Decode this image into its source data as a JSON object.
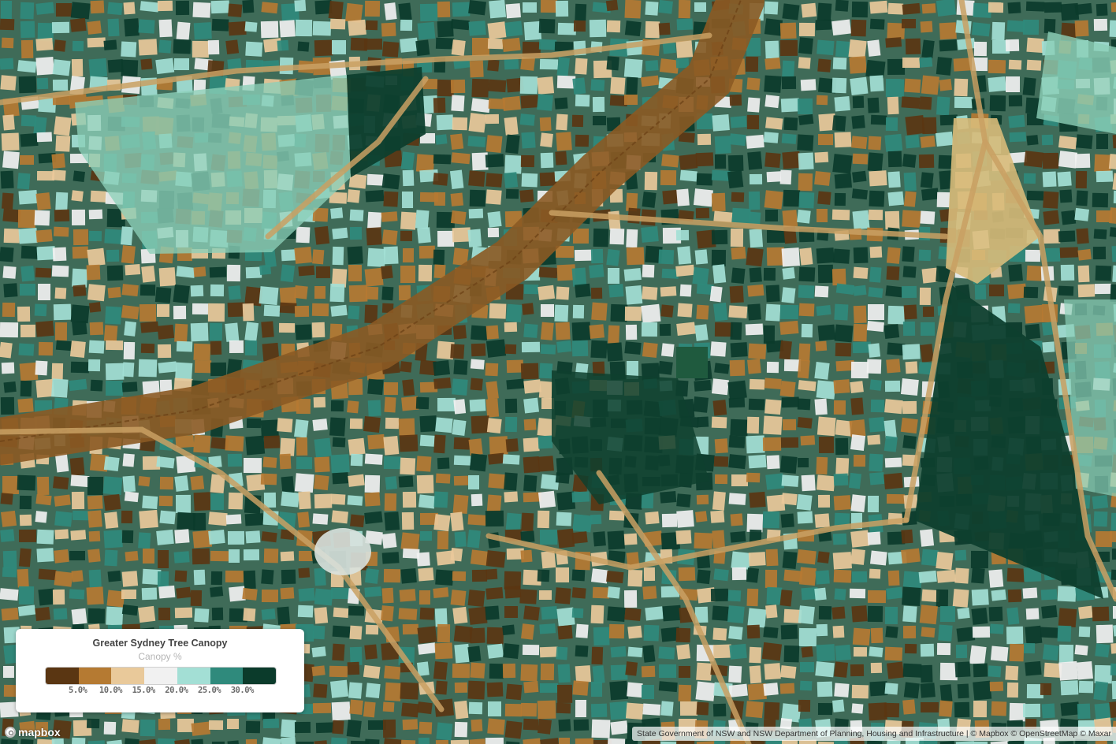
{
  "legend": {
    "title": "Greater Sydney Tree Canopy",
    "subtitle": "Canopy %",
    "colors": [
      "#5a3612",
      "#b57a32",
      "#e9c99a",
      "#f1f1f1",
      "#a3dfd5",
      "#2f8a7c",
      "#0b3b2b"
    ],
    "ticks": [
      "5.0%",
      "10.0%",
      "15.0%",
      "20.0%",
      "25.0%",
      "30.0%"
    ]
  },
  "attribution": {
    "text": "State Government of NSW and NSW Department of Planning, Housing and Infrastructure | © Mapbox © OpenStreetMap © Maxar"
  },
  "logo": {
    "text": "mapbox"
  },
  "palette": {
    "road": "#c9a063",
    "rail": "#8b5a24",
    "park_dark": "#0e3f2e",
    "park_light": "#8ccfb8"
  }
}
